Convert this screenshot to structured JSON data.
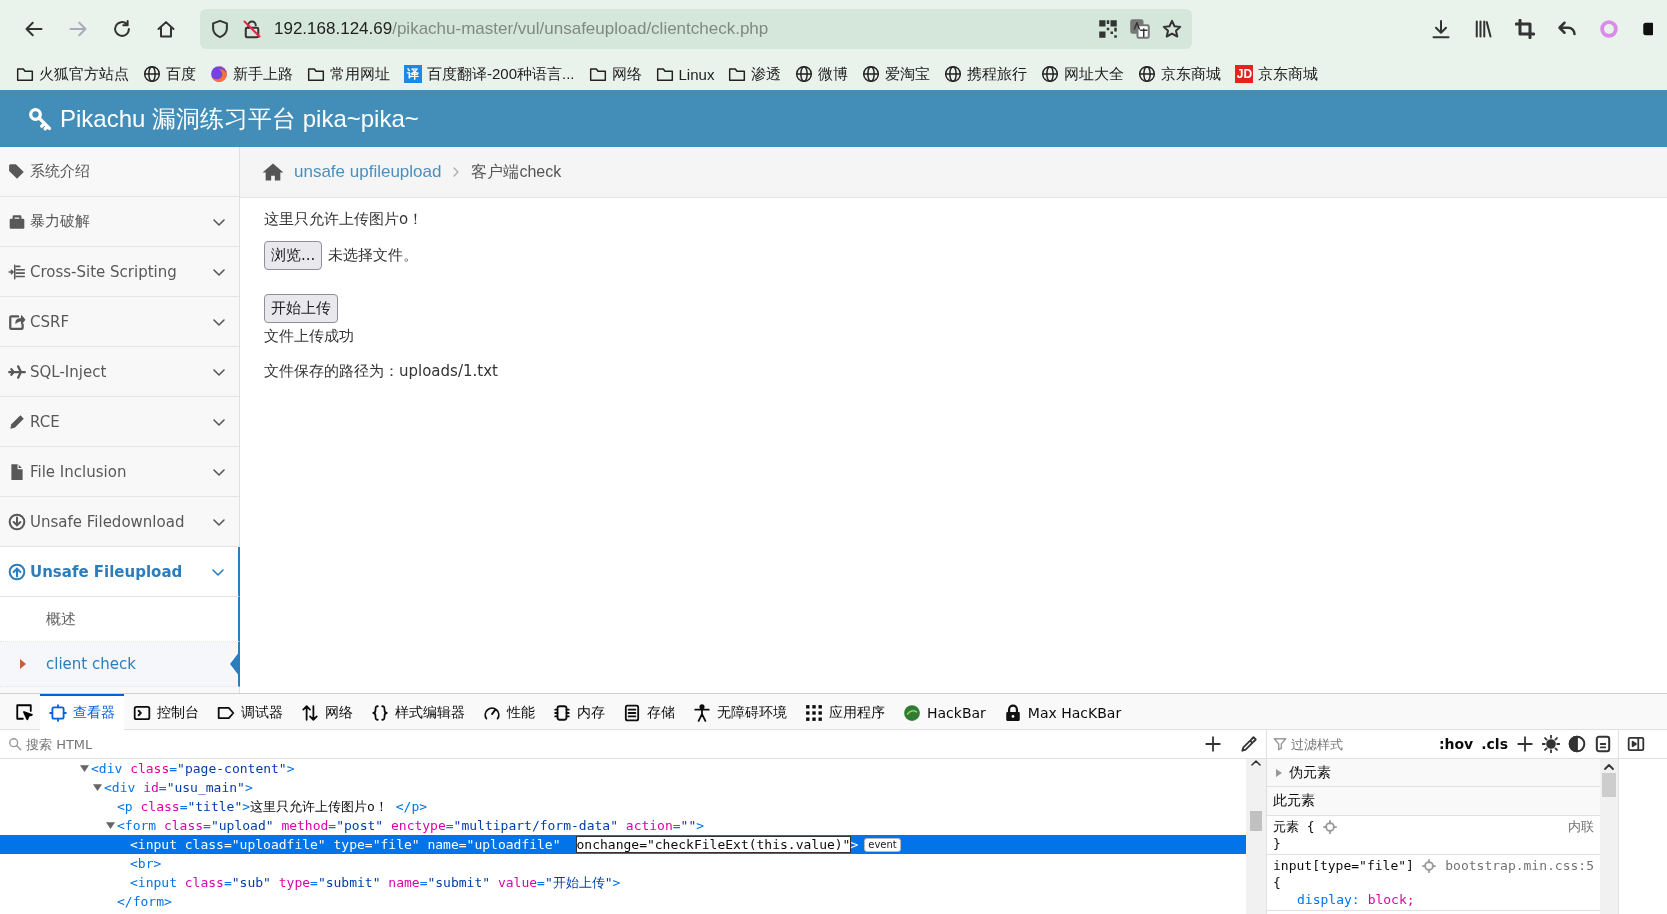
{
  "browser": {
    "nav_buttons": [
      {
        "disabled": false
      },
      {
        "disabled": true
      },
      {
        "disabled": false
      },
      {
        "disabled": false
      }
    ],
    "url": {
      "host": "192.168.124.69",
      "path": "/pikachu-master/vul/unsafeupload/clientcheck.php"
    },
    "bookmarks": [
      {
        "kind": "folder",
        "label": "火狐官方站点"
      },
      {
        "kind": "globe",
        "label": "百度"
      },
      {
        "kind": "app",
        "label": "新手上路"
      },
      {
        "kind": "folder",
        "label": "常用网址"
      },
      {
        "kind": "badge",
        "badge": "译",
        "color": "#1e88e5",
        "label": "百度翻译-200种语言..."
      },
      {
        "kind": "folder",
        "label": "网络"
      },
      {
        "kind": "folder",
        "label": "Linux"
      },
      {
        "kind": "folder",
        "label": "渗透"
      },
      {
        "kind": "globe",
        "label": "微博"
      },
      {
        "kind": "globe",
        "label": "爱淘宝"
      },
      {
        "kind": "globe",
        "label": "携程旅行"
      },
      {
        "kind": "globe",
        "label": "网址大全"
      },
      {
        "kind": "globe",
        "label": "京东商城"
      },
      {
        "kind": "badge",
        "badge": "JD",
        "color": "#e1251b",
        "label": "京东商城"
      }
    ]
  },
  "app": {
    "title": "Pikachu 漏洞练习平台 pika~pika~"
  },
  "sidebar": {
    "items": [
      {
        "label": "系统介绍",
        "expandable": false,
        "selected": false
      },
      {
        "label": "暴力破解",
        "expandable": true,
        "selected": false
      },
      {
        "label": "Cross-Site Scripting",
        "expandable": true,
        "selected": false
      },
      {
        "label": "CSRF",
        "expandable": true,
        "selected": false
      },
      {
        "label": "SQL-Inject",
        "expandable": true,
        "selected": false
      },
      {
        "label": "RCE",
        "expandable": true,
        "selected": false
      },
      {
        "label": "File Inclusion",
        "expandable": true,
        "selected": false
      },
      {
        "label": "Unsafe Filedownload",
        "expandable": true,
        "selected": false
      },
      {
        "label": "Unsafe Fileupload",
        "expandable": true,
        "selected": true,
        "children": [
          {
            "label": "概述",
            "selected": false
          },
          {
            "label": "client check",
            "selected": true
          }
        ]
      }
    ]
  },
  "breadcrumb": {
    "link": "unsafe upfileupload",
    "current": "客户端check"
  },
  "content": {
    "title": "这里只允许上传图片o！",
    "file_button": "浏览...",
    "file_status": "未选择文件。",
    "submit": "开始上传",
    "message": "文件上传成功",
    "path": "文件保存的路径为：uploads/1.txt"
  },
  "devtools": {
    "tabs": [
      {
        "label": "查看器",
        "selected": true
      },
      {
        "label": "控制台",
        "selected": false
      },
      {
        "label": "调试器",
        "selected": false
      },
      {
        "label": "网络",
        "selected": false
      },
      {
        "label": "样式编辑器",
        "selected": false
      },
      {
        "label": "性能",
        "selected": false
      },
      {
        "label": "内存",
        "selected": false
      },
      {
        "label": "存储",
        "selected": false
      },
      {
        "label": "无障碍环境",
        "selected": false
      },
      {
        "label": "应用程序",
        "selected": false
      },
      {
        "label": "HackBar",
        "selected": false
      },
      {
        "label": "Max HacKBar",
        "selected": false
      }
    ],
    "search_placeholder": "搜索 HTML",
    "tree": [
      {
        "expanded": true,
        "selected": false,
        "tokens": [
          {
            "kind": "tag",
            "text": "<div"
          },
          {
            "kind": "attr",
            "text": " class"
          },
          {
            "kind": "tag",
            "text": "="
          },
          {
            "kind": "value",
            "text": "\"page-content\""
          },
          {
            "kind": "tag",
            "text": ">"
          }
        ],
        "children": [
          {
            "expanded": true,
            "selected": false,
            "tokens": [
              {
                "kind": "tag",
                "text": "<div"
              },
              {
                "kind": "attr",
                "text": " id"
              },
              {
                "kind": "tag",
                "text": "="
              },
              {
                "kind": "value",
                "text": "\"usu_main\""
              },
              {
                "kind": "tag",
                "text": ">"
              }
            ],
            "children": [
              {
                "selected": false,
                "tokens": [
                  {
                    "kind": "tag",
                    "text": "<p"
                  },
                  {
                    "kind": "attr",
                    "text": " class"
                  },
                  {
                    "kind": "tag",
                    "text": "="
                  },
                  {
                    "kind": "value",
                    "text": "\"title\""
                  },
                  {
                    "kind": "tag",
                    "text": ">"
                  },
                  {
                    "kind": "text",
                    "text": "这里只允许上传图片o！ "
                  },
                  {
                    "kind": "tag",
                    "text": "</p>"
                  }
                ]
              },
              {
                "expanded": true,
                "selected": false,
                "tokens": [
                  {
                    "kind": "tag",
                    "text": "<form"
                  },
                  {
                    "kind": "attr",
                    "text": " class"
                  },
                  {
                    "kind": "tag",
                    "text": "="
                  },
                  {
                    "kind": "value",
                    "text": "\"upload\""
                  },
                  {
                    "kind": "attr",
                    "text": " method"
                  },
                  {
                    "kind": "tag",
                    "text": "="
                  },
                  {
                    "kind": "value",
                    "text": "\"post\""
                  },
                  {
                    "kind": "attr",
                    "text": " enctype"
                  },
                  {
                    "kind": "tag",
                    "text": "="
                  },
                  {
                    "kind": "value",
                    "text": "\"multipart/form-data\""
                  },
                  {
                    "kind": "attr",
                    "text": " action"
                  },
                  {
                    "kind": "tag",
                    "text": "="
                  },
                  {
                    "kind": "value",
                    "text": "\"\""
                  },
                  {
                    "kind": "tag",
                    "text": ">"
                  }
                ],
                "children": [
                  {
                    "selected": true,
                    "badge": "event",
                    "tokens": [
                      {
                        "kind": "tag",
                        "text": "<input"
                      },
                      {
                        "kind": "attr",
                        "text": " class"
                      },
                      {
                        "kind": "tag",
                        "text": "="
                      },
                      {
                        "kind": "value",
                        "text": "\"uploadfile\""
                      },
                      {
                        "kind": "attr",
                        "text": " type"
                      },
                      {
                        "kind": "tag",
                        "text": "="
                      },
                      {
                        "kind": "value",
                        "text": "\"file\""
                      },
                      {
                        "kind": "attr",
                        "text": " name"
                      },
                      {
                        "kind": "tag",
                        "text": "="
                      },
                      {
                        "kind": "value",
                        "text": "\"uploadfile\""
                      },
                      {
                        "kind": "editing",
                        "text": "onchange=\"checkFileExt(this.value)\""
                      },
                      {
                        "kind": "tag",
                        "text": ">"
                      }
                    ]
                  },
                  {
                    "selected": false,
                    "tokens": [
                      {
                        "kind": "tag",
                        "text": "<br>"
                      }
                    ]
                  },
                  {
                    "selected": false,
                    "tokens": [
                      {
                        "kind": "tag",
                        "text": "<input"
                      },
                      {
                        "kind": "attr",
                        "text": " class"
                      },
                      {
                        "kind": "tag",
                        "text": "="
                      },
                      {
                        "kind": "value",
                        "text": "\"sub\""
                      },
                      {
                        "kind": "attr",
                        "text": " type"
                      },
                      {
                        "kind": "tag",
                        "text": "="
                      },
                      {
                        "kind": "value",
                        "text": "\"submit\""
                      },
                      {
                        "kind": "attr",
                        "text": " name"
                      },
                      {
                        "kind": "tag",
                        "text": "="
                      },
                      {
                        "kind": "value",
                        "text": "\"submit\""
                      },
                      {
                        "kind": "attr",
                        "text": " value"
                      },
                      {
                        "kind": "tag",
                        "text": "="
                      },
                      {
                        "kind": "value",
                        "text": "\"开始上传\""
                      },
                      {
                        "kind": "tag",
                        "text": ">"
                      }
                    ]
                  }
                ]
              },
              {
                "selected": false,
                "tokens": [
                  {
                    "kind": "tag",
                    "text": "</form>"
                  }
                ]
              }
            ]
          }
        ]
      }
    ],
    "styles": {
      "filter_placeholder": "过滤样式",
      "toggles": [
        ":hov",
        ".cls"
      ],
      "pseudo_section": "伪元素",
      "this_element": "此元素",
      "rules": [
        {
          "selector": "元素 {",
          "source": "内联",
          "lines": [
            {
              "kind": "brace",
              "text": "}"
            }
          ]
        },
        {
          "selector": "input[type=\"file\"]",
          "source": "bootstrap.min.css:5",
          "lines": [
            {
              "kind": "brace",
              "text": "{"
            },
            {
              "kind": "declaration",
              "property": "display:",
              "value": "block;"
            }
          ]
        }
      ]
    }
  }
}
